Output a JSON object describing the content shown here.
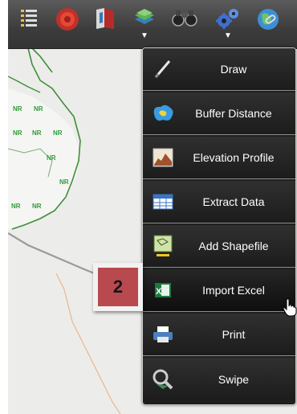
{
  "toolbar": {
    "buttons": [
      {
        "icon": "legend-list-icon",
        "has_dropdown": false
      },
      {
        "icon": "target-icon",
        "has_dropdown": false
      },
      {
        "icon": "bookmarks-icon",
        "has_dropdown": false
      },
      {
        "icon": "layers-tools-icon",
        "has_dropdown": true
      },
      {
        "icon": "binoculars-icon",
        "has_dropdown": false
      },
      {
        "icon": "gears-icon",
        "has_dropdown": true
      },
      {
        "icon": "globe-link-icon",
        "has_dropdown": false
      }
    ],
    "caret": "▼"
  },
  "map": {
    "labels": [
      "NR",
      "NR",
      "NR",
      "NR",
      "NR",
      "NR",
      "NR",
      "NR",
      "NR"
    ]
  },
  "menu": {
    "items": [
      {
        "label": "Draw",
        "icon": "pencil-icon"
      },
      {
        "label": "Buffer Distance",
        "icon": "buffer-blob-icon"
      },
      {
        "label": "Elevation Profile",
        "icon": "elevation-chart-icon"
      },
      {
        "label": "Extract Data",
        "icon": "table-extract-icon"
      },
      {
        "label": "Add Shapefile",
        "icon": "shapefile-icon"
      },
      {
        "label": "Import Excel",
        "icon": "excel-icon"
      },
      {
        "label": "Print",
        "icon": "printer-icon"
      },
      {
        "label": "Swipe",
        "icon": "swipe-icon"
      }
    ]
  },
  "step_badge": {
    "text": "2"
  },
  "colors": {
    "badge_red": "#b84a4f",
    "map_green_line": "#3f8f3a",
    "map_label_green": "#2e9b3b",
    "menu_bg": "#1f1f1f"
  }
}
